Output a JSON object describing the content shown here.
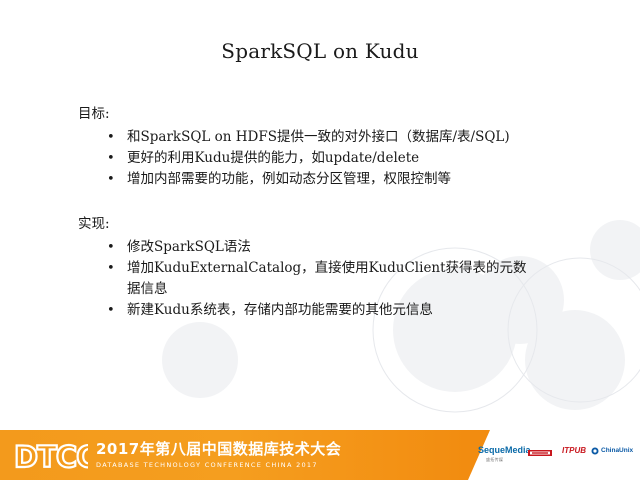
{
  "slide": {
    "title": "SparkSQL on Kudu"
  },
  "goals": {
    "heading": "目标:",
    "items": [
      "和SparkSQL on HDFS提供一致的对外接口（数据库/表/SQL)",
      "更好的利用Kudu提供的能力，如update/delete",
      "增加内部需要的功能，例如动态分区管理，权限控制等"
    ]
  },
  "implementation": {
    "heading": "实现:",
    "items": [
      "修改SparkSQL语法",
      "增加KuduExternalCatalog，直接使用KuduClient获得表的元数据信息",
      "新建Kudu系统表，存储内部功能需要的其他元信息"
    ]
  },
  "bullet_symbol": "•",
  "footer": {
    "logo_text": "DTCC",
    "conference_title": "2017年第八届中国数据库技术大会",
    "conference_subtitle": "DATABASE  TECHNOLOGY  CONFERENCE  CHINA  2017",
    "sponsors": {
      "sequemedia": "SequeMedia",
      "sequemedia_sub": "盛拓传媒",
      "itpub": "ITPUB",
      "chinaunix": "ChinaUnix"
    },
    "colors": {
      "orange": "#f39a1c",
      "white": "#ffffff"
    }
  }
}
